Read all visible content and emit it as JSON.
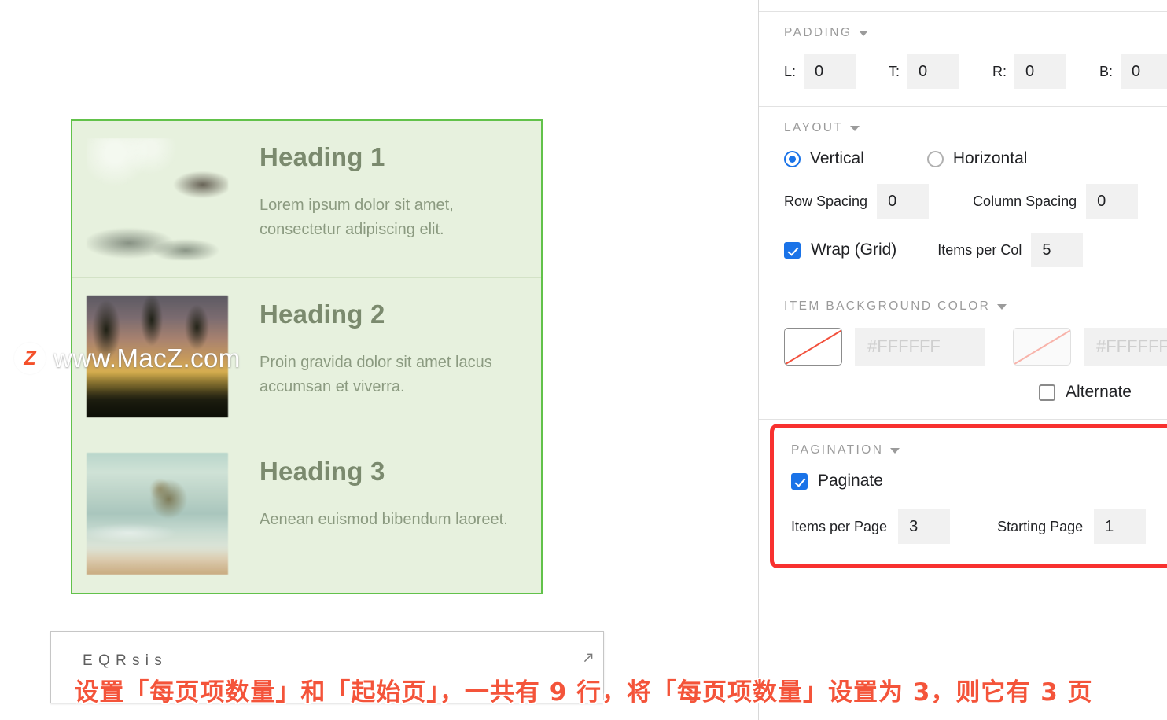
{
  "canvas": {
    "list_items": [
      {
        "heading": "Heading 1",
        "body": "Lorem ipsum dolor sit amet, consectetur adipiscing elit.",
        "image": "coastal-cliff-photo"
      },
      {
        "heading": "Heading 2",
        "body": "Proin gravida dolor sit amet lacus accumsan et viverra.",
        "image": "palm-sunset-photo"
      },
      {
        "heading": "Heading 3",
        "body": "Aenean euismod bibendum laoreet.",
        "image": "rock-in-surf-photo"
      }
    ],
    "bottom_widget": {
      "ghost_text": "E   Q R  s i  s",
      "resize_icon": "resize-arrow-icon"
    }
  },
  "watermark": {
    "badge": "Z",
    "text": "www.MacZ.com"
  },
  "inspector": {
    "padding": {
      "title": "PADDING",
      "caret": "chevron-down-icon",
      "fields": [
        {
          "label": "L:",
          "value": "0"
        },
        {
          "label": "T:",
          "value": "0"
        },
        {
          "label": "R:",
          "value": "0"
        },
        {
          "label": "B:",
          "value": "0"
        }
      ]
    },
    "layout": {
      "title": "LAYOUT",
      "caret": "chevron-down-icon",
      "direction": {
        "vertical": "Vertical",
        "horizontal": "Horizontal",
        "selected": "Vertical"
      },
      "row_spacing": {
        "label": "Row Spacing",
        "value": "0"
      },
      "column_spacing": {
        "label": "Column Spacing",
        "value": "0"
      },
      "wrap": {
        "label": "Wrap (Grid)",
        "checked": true
      },
      "items_per_col": {
        "label": "Items per Col",
        "value": "5"
      }
    },
    "item_background_color": {
      "title": "ITEM BACKGROUND COLOR",
      "caret": "chevron-down-icon",
      "primary_swatch": "no-color-swatch",
      "primary_hex": "#FFFFFF",
      "alternate_swatch": "no-color-swatch-disabled",
      "alternate_hex": "#FFFFFF",
      "alternate": {
        "label": "Alternate",
        "checked": false
      }
    },
    "pagination": {
      "title": "PAGINATION",
      "caret": "chevron-down-icon",
      "paginate": {
        "label": "Paginate",
        "checked": true
      },
      "items_per_page": {
        "label": "Items per Page",
        "value": "3"
      },
      "starting_page": {
        "label": "Starting Page",
        "value": "1"
      },
      "highlight_color": "#F8312F"
    }
  },
  "annotation": {
    "text": "设置「每页项数量」和「起始页」，一共有 9 行，将「每页项数量」设置为 3，则它有 3 页",
    "color": "#F4543A"
  }
}
